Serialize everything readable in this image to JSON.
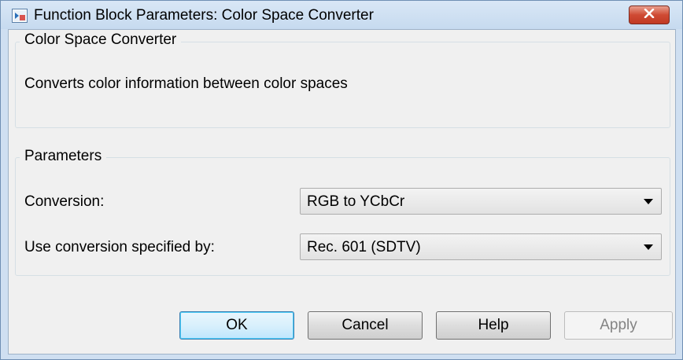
{
  "window": {
    "title": "Function Block Parameters: Color Space Converter",
    "close_icon": "close-icon"
  },
  "description_group": {
    "label": "Color Space Converter",
    "text": "Converts color information between color spaces"
  },
  "parameters_group": {
    "label": "Parameters",
    "conversion": {
      "label": "Conversion:",
      "value": "RGB to YCbCr"
    },
    "conversion_spec": {
      "label": "Use conversion specified by:",
      "value": "Rec. 601 (SDTV)"
    }
  },
  "buttons": {
    "ok": "OK",
    "cancel": "Cancel",
    "help": "Help",
    "apply": "Apply"
  },
  "colors": {
    "close_button": "#c13a24",
    "default_button_border": "#3c7fb1"
  }
}
